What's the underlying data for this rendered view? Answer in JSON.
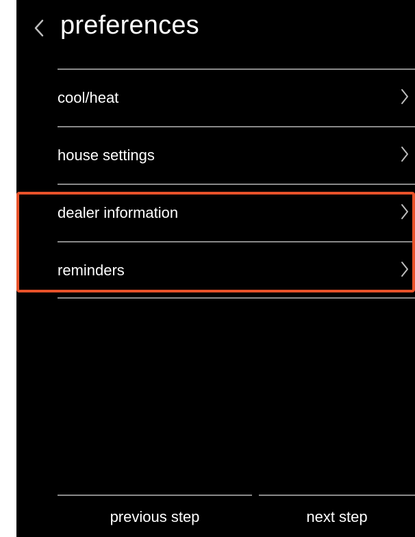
{
  "header": {
    "title": "preferences",
    "back_icon": "chevron-left-icon"
  },
  "menu": {
    "items": [
      {
        "label": "cool/heat",
        "icon": "chevron-right-icon"
      },
      {
        "label": "house settings",
        "icon": "chevron-right-icon"
      },
      {
        "label": "dealer information",
        "icon": "chevron-right-icon"
      },
      {
        "label": "reminders",
        "icon": "chevron-right-icon"
      }
    ]
  },
  "footer": {
    "previous_label": "previous step",
    "next_label": "next step"
  },
  "colors": {
    "background": "#000000",
    "text": "#ffffff",
    "divider": "#8a8a8a",
    "highlight": "#e8522a"
  }
}
